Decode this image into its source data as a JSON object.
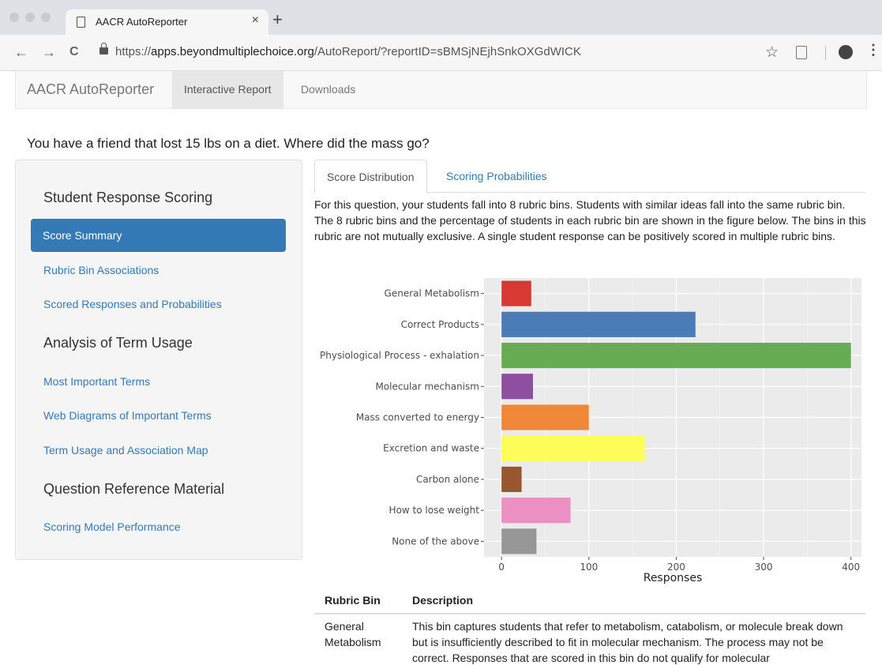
{
  "browser": {
    "tab_title": "AACR AutoReporter",
    "tab_close": "×",
    "new_tab": "+",
    "url_scheme": "https://",
    "url_host": "apps.beyondmultiplechoice.org",
    "url_path": "/AutoReport/?reportID=sBMSjNEjhSnkOXGdWICK",
    "back_glyph": "←",
    "forward_glyph": "→",
    "reload_glyph": "C",
    "star_glyph": "☆",
    "menu_glyph": "⋮"
  },
  "navbar": {
    "brand": "AACR AutoReporter",
    "links": [
      {
        "label": "Interactive Report"
      },
      {
        "label": "Downloads"
      }
    ]
  },
  "question": "You have a friend that lost 15 lbs on a diet. Where did the mass go?",
  "sidebar": {
    "headings": [
      "Student Response Scoring",
      "Analysis of Term Usage",
      "Question Reference Material"
    ],
    "active_item": "Score Summary",
    "links": [
      "Rubric Bin Associations",
      "Scored Responses and Probabilities",
      "Most Important Terms",
      "Web Diagrams of Important Terms",
      "Term Usage and Association Map",
      "Scoring Model Performance"
    ]
  },
  "main_tabs": [
    "Score Distribution",
    "Scoring Probabilities"
  ],
  "intro": "For this question, your students fall into 8 rubric bins. Students with similar ideas fall into the same rubric bin. The 8 rubric bins and the percentage of students in each rubric bin are shown in the figure below. The bins in this rubric are not mutually exclusive. A single student response can be positively scored in multiple rubric bins.",
  "chart_data": {
    "type": "bar",
    "orientation": "horizontal",
    "categories": [
      "General Metabolism",
      "Correct Products",
      "Physiological Process - exhalation",
      "Molecular mechanism",
      "Mass converted to energy",
      "Excretion and waste",
      "Carbon alone",
      "How to lose weight",
      "None of the above"
    ],
    "values": [
      34,
      222,
      400,
      36,
      100,
      164,
      23,
      79,
      40
    ],
    "colors": [
      "#d73a33",
      "#4a7cb8",
      "#66ac52",
      "#8e4fa0",
      "#f0883a",
      "#fdfd58",
      "#98572f",
      "#ec8fc2",
      "#979797"
    ],
    "xlabel": "Responses",
    "ylabel": "",
    "xlim": [
      -20,
      412
    ],
    "xticks": [
      0,
      100,
      200,
      300,
      400
    ],
    "grid": true,
    "background": "#ebebeb"
  },
  "table": {
    "headers": [
      "Rubric Bin",
      "Description"
    ],
    "rows": [
      {
        "bin_line1": "General",
        "bin_line2": "Metabolism",
        "description": "This bin captures students that refer to metabolism, catabolism, or molecule break down but is insufficiently described to fit in molecular mechanism. The process may not be correct. Responses that are scored in this bin do not qualify for molecular"
      }
    ]
  }
}
